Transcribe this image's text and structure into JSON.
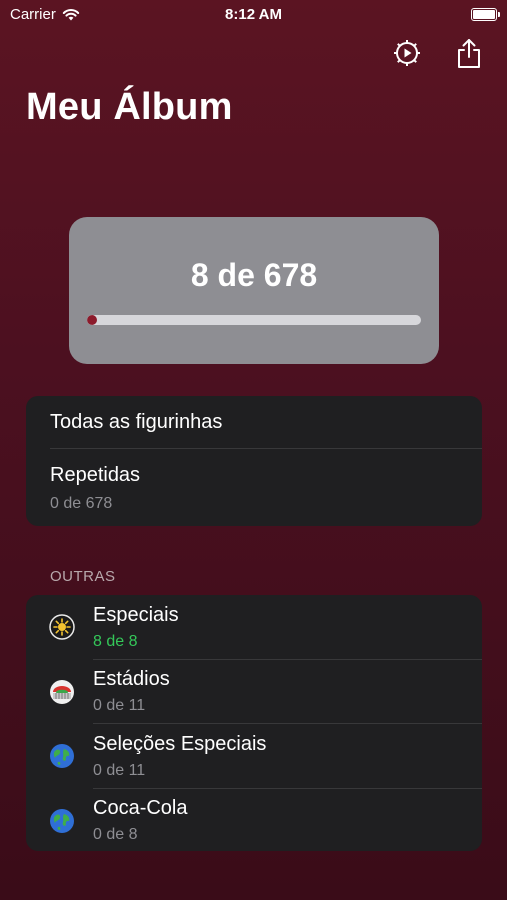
{
  "status_bar": {
    "carrier": "Carrier",
    "time": "8:12 AM"
  },
  "header": {
    "title": "Meu Álbum",
    "settings_icon": "gear-play-icon",
    "share_icon": "share-icon"
  },
  "progress": {
    "text": "8 de 678",
    "collected": 8,
    "total": 678,
    "fraction": 0.0118,
    "fill_color": "#8c1b2c"
  },
  "main_list": [
    {
      "title": "Todas as figurinhas"
    },
    {
      "title": "Repetidas",
      "subtitle": "0 de 678"
    }
  ],
  "other_section": {
    "header": "OUTRAS",
    "items": [
      {
        "title": "Especiais",
        "subtitle": "8 de 8",
        "icon": "sun-badge-icon",
        "complete": true
      },
      {
        "title": "Estádios",
        "subtitle": "0 de 11",
        "icon": "stadium-icon",
        "complete": false
      },
      {
        "title": "Seleções Especiais",
        "subtitle": "0 de 11",
        "icon": "globe-icon",
        "complete": false
      },
      {
        "title": "Coca-Cola",
        "subtitle": "0 de 8",
        "icon": "globe-icon",
        "complete": false
      }
    ]
  },
  "colors": {
    "background": "#4c1020",
    "card": "#8e8e93",
    "list_bg": "#1f1f21",
    "complete_green": "#34c759"
  }
}
